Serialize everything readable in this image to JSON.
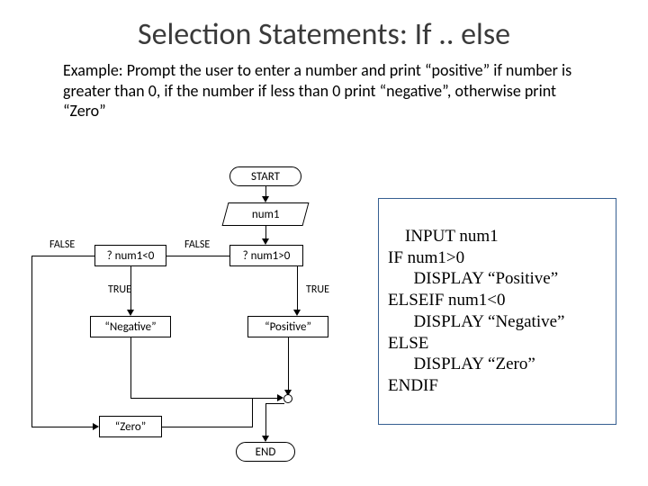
{
  "title": "Selection Statements: If .. else",
  "example": "Example: Prompt the user to enter a number and print “positive” if number is greater than 0, if the number if less than 0 print “negative”, otherwise print “Zero”",
  "flowchart": {
    "start": "START",
    "input": "num1",
    "decision_gt": "? num1>0",
    "decision_lt": "? num1<0",
    "out_positive": "“Positive”",
    "out_negative": "“Negative”",
    "out_zero": "“Zero”",
    "end": "END",
    "label_true": "TRUE",
    "label_false": "FALSE",
    "label_true2": "TRUE",
    "label_false2": "FALSE"
  },
  "pseudocode": "INPUT num1\nIF num1>0\n      DISPLAY “Positive”\nELSEIF num1<0\n      DISPLAY “Negative”\nELSE\n      DISPLAY “Zero”\nENDIF",
  "chart_data": {
    "type": "flowchart",
    "nodes": [
      {
        "id": "start",
        "kind": "terminator",
        "label": "START"
      },
      {
        "id": "input",
        "kind": "input",
        "label": "num1"
      },
      {
        "id": "dec_gt",
        "kind": "decision",
        "label": "? num1>0"
      },
      {
        "id": "dec_lt",
        "kind": "decision",
        "label": "? num1<0"
      },
      {
        "id": "positive",
        "kind": "process",
        "label": "\"Positive\""
      },
      {
        "id": "negative",
        "kind": "process",
        "label": "\"Negative\""
      },
      {
        "id": "zero",
        "kind": "process",
        "label": "\"Zero\""
      },
      {
        "id": "join",
        "kind": "connector",
        "label": ""
      },
      {
        "id": "end",
        "kind": "terminator",
        "label": "END"
      }
    ],
    "edges": [
      {
        "from": "start",
        "to": "input"
      },
      {
        "from": "input",
        "to": "dec_gt"
      },
      {
        "from": "dec_gt",
        "to": "positive",
        "label": "TRUE"
      },
      {
        "from": "dec_gt",
        "to": "dec_lt",
        "label": "FALSE"
      },
      {
        "from": "dec_lt",
        "to": "negative",
        "label": "TRUE"
      },
      {
        "from": "dec_lt",
        "to": "zero",
        "label": "FALSE"
      },
      {
        "from": "positive",
        "to": "join"
      },
      {
        "from": "negative",
        "to": "join"
      },
      {
        "from": "zero",
        "to": "join"
      },
      {
        "from": "join",
        "to": "end"
      }
    ]
  }
}
